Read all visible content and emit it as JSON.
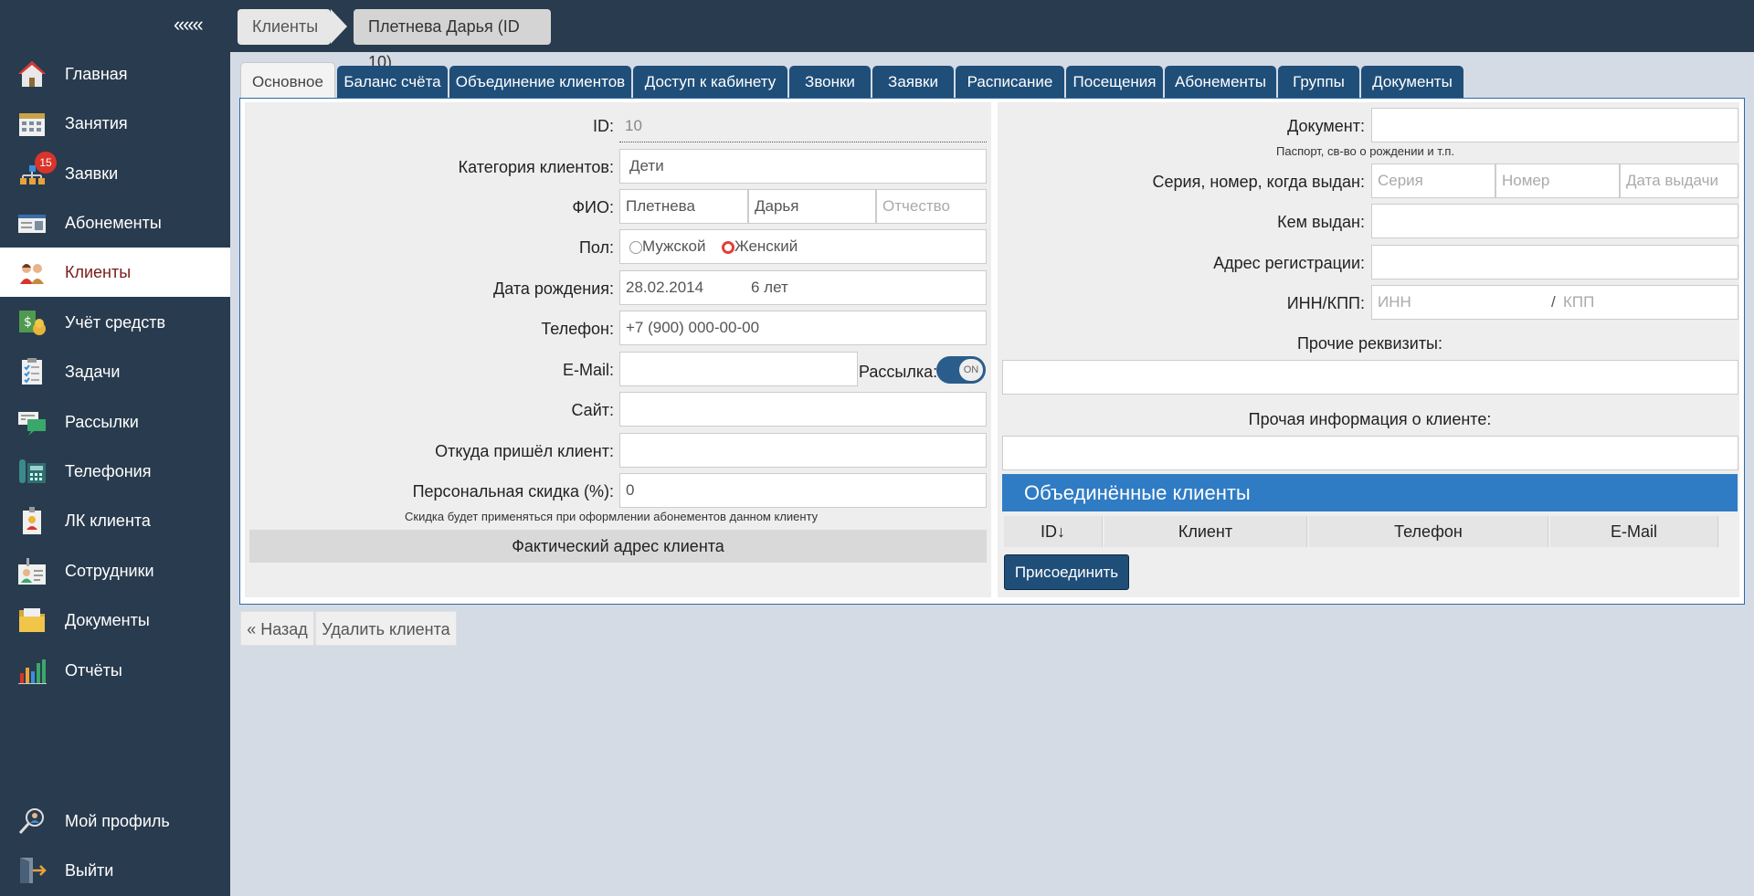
{
  "sidebar": {
    "collapse": "«««",
    "items": [
      {
        "label": "Главная",
        "icon": "home-icon"
      },
      {
        "label": "Занятия",
        "icon": "calendar-icon"
      },
      {
        "label": "Заявки",
        "icon": "requests-icon",
        "badge": "15"
      },
      {
        "label": "Абонементы",
        "icon": "subscription-card-icon"
      },
      {
        "label": "Клиенты",
        "icon": "clients-icon"
      },
      {
        "label": "Учёт средств",
        "icon": "money-icon"
      },
      {
        "label": "Задачи",
        "icon": "tasks-icon"
      },
      {
        "label": "Рассылки",
        "icon": "mailing-icon"
      },
      {
        "label": "Телефония",
        "icon": "phone-icon"
      },
      {
        "label": "ЛК клиента",
        "icon": "client-cabinet-icon"
      },
      {
        "label": "Сотрудники",
        "icon": "staff-icon"
      },
      {
        "label": "Документы",
        "icon": "documents-icon"
      },
      {
        "label": "Отчёты",
        "icon": "reports-icon"
      }
    ],
    "profile": "Мой профиль",
    "logout": "Выйти"
  },
  "breadcrumb": {
    "root": "Клиенты",
    "current": "Плетнева Дарья (ID 10)"
  },
  "tabs": [
    "Основное",
    "Баланс счёта",
    "Объединение клиентов",
    "Доступ к кабинету",
    "Звонки",
    "Заявки",
    "Расписание",
    "Посещения",
    "Абонементы",
    "Группы",
    "Документы"
  ],
  "left_form": {
    "id_label": "ID:",
    "id_value": "10",
    "category_label": "Категория клиентов:",
    "category_value": "Дети",
    "fio_label": "ФИО:",
    "last_name": "Плетнева",
    "first_name": "Дарья",
    "middle_name_placeholder": "Отчество",
    "gender_label": "Пол:",
    "gender_male": "Мужской",
    "gender_female": "Женский",
    "birth_label": "Дата рождения:",
    "birth_value": "28.02.2014",
    "age": "6 лет",
    "phone_label": "Телефон:",
    "phone_value": "+7 (900) 000-00-00",
    "email_label": "E-Mail:",
    "mailing_label": "Рассылка:",
    "mailing_toggle": "ON",
    "site_label": "Сайт:",
    "source_label": "Откуда пришёл клиент:",
    "discount_label": "Персональная скидка (%):",
    "discount_value": "0",
    "discount_hint": "Скидка будет применяться при оформлении абонементов данном клиенту",
    "fact_address": "Фактический адрес клиента"
  },
  "right_form": {
    "document_label": "Документ:",
    "document_hint": "Паспорт, св-во о рождении и т.п.",
    "series_label": "Серия, номер, когда выдан:",
    "series_placeholder": "Серия",
    "number_placeholder": "Номер",
    "date_placeholder": "Дата выдачи",
    "issued_by_label": "Кем выдан:",
    "reg_address_label": "Адрес регистрации:",
    "inn_label": "ИНН/КПП:",
    "inn_placeholder": "ИНН",
    "inn_sep": "/",
    "kpp_placeholder": "КПП",
    "other_requisites_label": "Прочие реквизиты:",
    "other_info_label": "Прочая информация о клиенте:"
  },
  "merged": {
    "title": "Объединённые клиенты",
    "columns": [
      "ID↓",
      "Клиент",
      "Телефон",
      "E-Mail"
    ],
    "connect_button": "Присоединить"
  },
  "actions": {
    "back": "« Назад",
    "delete": "Удалить клиента"
  },
  "colors": {
    "sidebar_bg": "#293b4e",
    "tab_bg": "#1f4e79",
    "header_blue": "#2f7cc4",
    "active_label": "#7a1a1a",
    "badge": "#d9342b"
  }
}
